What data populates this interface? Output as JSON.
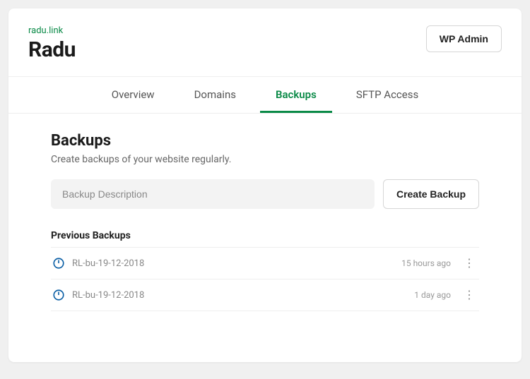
{
  "header": {
    "domain": "radu.link",
    "title": "Radu",
    "wp_admin": "WP Admin"
  },
  "tabs": [
    {
      "label": "Overview",
      "active": false
    },
    {
      "label": "Domains",
      "active": false
    },
    {
      "label": "Backups",
      "active": true
    },
    {
      "label": "SFTP Access",
      "active": false
    }
  ],
  "backups": {
    "title": "Backups",
    "subtitle": "Create backups of your website regularly.",
    "input_placeholder": "Backup Description",
    "create_button": "Create Backup",
    "previous_title": "Previous Backups",
    "items": [
      {
        "name": "RL-bu-19-12-2018",
        "time": "15 hours ago"
      },
      {
        "name": "RL-bu-19-12-2018",
        "time": "1 day ago"
      }
    ]
  }
}
